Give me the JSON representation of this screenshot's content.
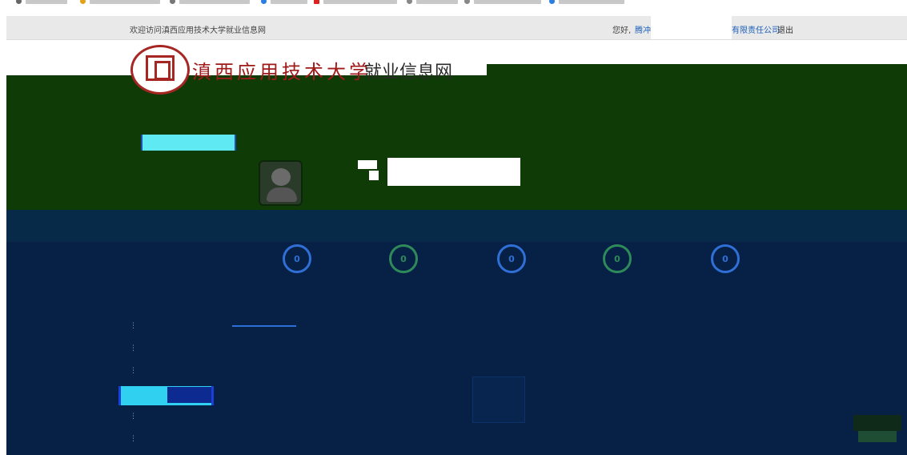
{
  "browser": {
    "bookmarks": [
      "",
      "",
      "",
      "",
      "",
      "",
      "",
      "",
      "",
      ""
    ]
  },
  "top_bar": {
    "welcome": "欢迎访问滇西应用技术大学就业信息网",
    "greeting": "您好,",
    "company_prefix": "腾冲",
    "company_suffix": "有限责任公司",
    "logout": "退出"
  },
  "brand": {
    "university_name": "滇西应用技术大学",
    "site_name": "就业信息网"
  },
  "nav": {
    "top_links": "",
    "sidebar_upper": [
      "",
      "",
      "",
      ""
    ],
    "sidebar_active": "",
    "sidebar_middle": [
      "",
      "",
      ""
    ]
  },
  "user_card": {
    "name_label": "",
    "right_label": "",
    "status_dots": ""
  },
  "stats": [
    {
      "value": "0",
      "label": "",
      "color": "#2f6fd6"
    },
    {
      "value": "0",
      "label": "",
      "color": "#2f8a5a"
    },
    {
      "value": "0",
      "label": "",
      "color": "#2f6fd6"
    },
    {
      "value": "0",
      "label": "",
      "color": "#2f8a5a"
    },
    {
      "value": "0",
      "label": "",
      "color": "#2f6fd6"
    }
  ],
  "tabs": {
    "active_tab": "",
    "more": ""
  },
  "menu": {
    "items": [
      "",
      "",
      "",
      "",
      ""
    ],
    "active": ""
  },
  "empty_state": {
    "text": ""
  },
  "floating_button": {
    "line1": "",
    "line2": ""
  },
  "colors": {
    "green_band": "#0f3b07",
    "navy_band": "#062046",
    "accent_cyan": "#5fe9f3",
    "seal_red": "#a62624",
    "link_blue": "#1c5fb8"
  }
}
